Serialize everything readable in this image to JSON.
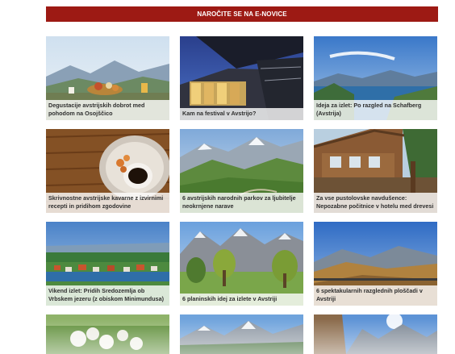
{
  "banner": {
    "label": "NAROČITE SE NA E-NOVICE"
  },
  "colors": {
    "banner": "#9d1a14",
    "caption_bg": "#ffffffcc",
    "caption_text": "#2f2f2f"
  },
  "cards": [
    {
      "caption": "Degustacije avstrijskih dobrot med pohodom na Osojščico",
      "image": "mountain-food-picnic"
    },
    {
      "caption": "Kam na festival v Avstrijo?",
      "image": "glass-pavilion-night"
    },
    {
      "caption": "Ideja za izlet: Po razgled na Schafberg (Avstrija)",
      "image": "alpine-lake-view"
    },
    {
      "caption": "Skrivnostne avstrijske kavarne z izvirnimi recepti in pridihom zgodovine",
      "image": "coffee-cup-tray"
    },
    {
      "caption": "6 avstrijskih narodnih parkov za ljubitelje neokrnjene narave",
      "image": "green-alpine-valley"
    },
    {
      "caption": "Za vse pustolovske navdušence: Nepozabne počitnice v hotelu med drevesi",
      "image": "wooden-treehouse-hotel"
    },
    {
      "caption": "Vikend izlet: Pridih Sredozemlja ob Vrbskem jezeru (z obiskom Minimundusa)",
      "image": "lake-town-aerial"
    },
    {
      "caption": "6 planinskih idej za izlete v Avstriji",
      "image": "mountain-meadow-trees"
    },
    {
      "caption": "6 spektakularnih razglednih ploščadi v Avstriji",
      "image": "mountain-ridge-viewpoint"
    },
    {
      "caption": "",
      "image": "white-flowers-meadow"
    },
    {
      "caption": "",
      "image": "snowy-peaks-forest"
    },
    {
      "caption": "",
      "image": "rock-peaks-sunburst"
    }
  ]
}
